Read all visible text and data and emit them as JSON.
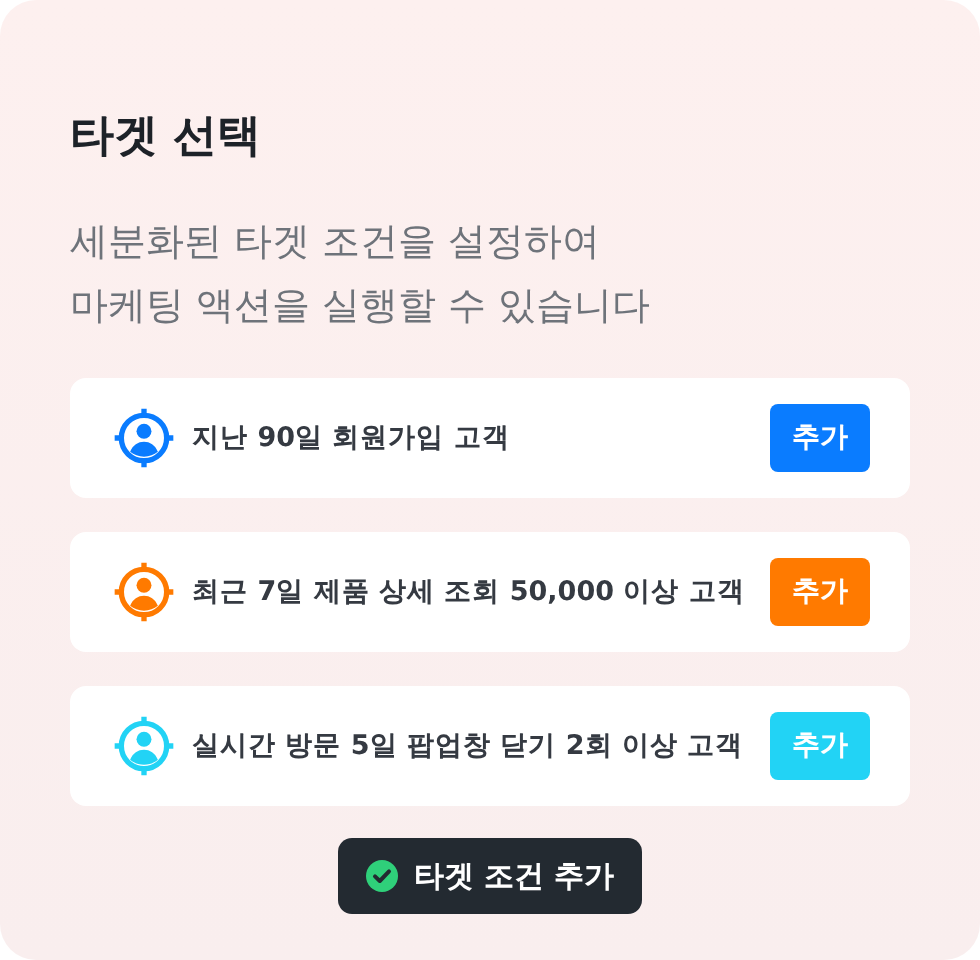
{
  "title": "타겟 선택",
  "description_lines": [
    "세분화된 타겟 조건을 설정하여",
    "마케팅 액션을 실행할 수 있습니다"
  ],
  "targets": [
    {
      "label": "지난 90일 회원가입 고객",
      "button": "추가",
      "color": "#0a7cff"
    },
    {
      "label": "최근 7일 제품 상세 조회 50,000 이상 고객",
      "button": "추가",
      "color": "#ff7a00"
    },
    {
      "label": "실시간 방문 5일 팝업창 닫기 2회 이상 고객",
      "button": "추가",
      "color": "#22d3f5"
    }
  ],
  "toast": {
    "text": "타겟 조건 추가"
  }
}
